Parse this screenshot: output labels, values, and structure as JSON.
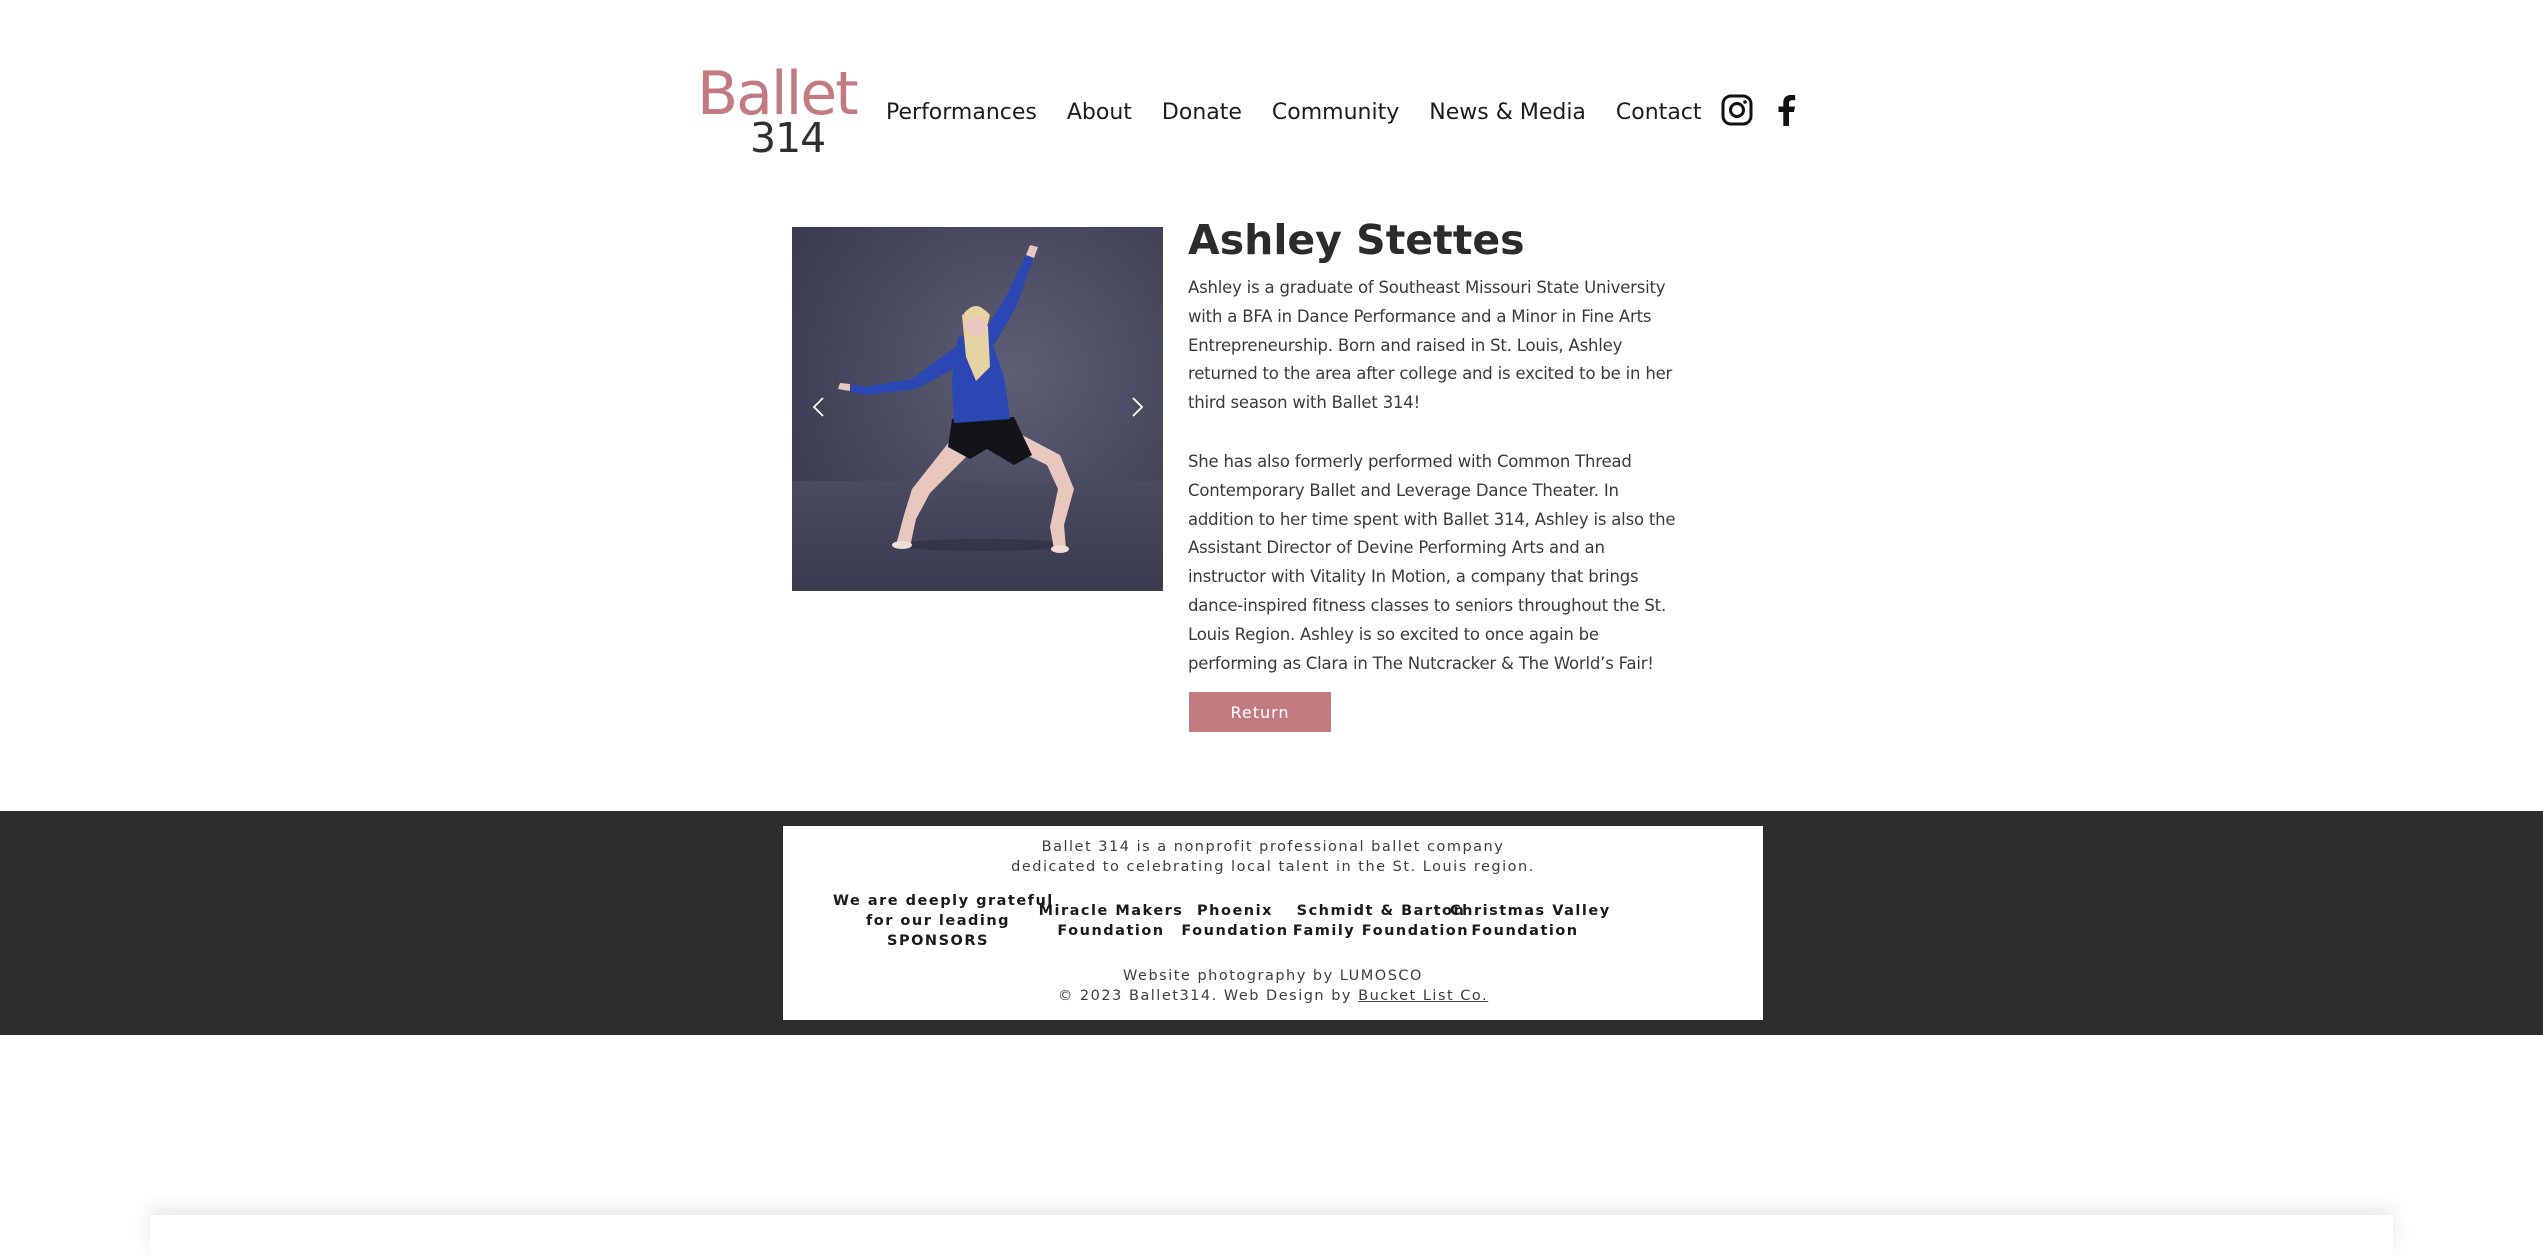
{
  "header": {
    "logo_word": "Ballet",
    "logo_number": "314",
    "nav": [
      "Performances",
      "About",
      "Donate",
      "Community",
      "News & Media",
      "Contact"
    ],
    "social_icons": [
      "instagram-icon",
      "facebook-icon"
    ]
  },
  "slideshow": {
    "prev_icon": "chevron-left-icon",
    "next_icon": "chevron-right-icon"
  },
  "profile": {
    "name": "Ashley Stettes",
    "bio_1": "Ashley is a graduate of Southeast Missouri State University with a BFA in Dance Performance and a Minor in Fine Arts Entrepreneurship. Born and raised in St. Louis, Ashley returned to the area after college and is excited to be in her third season with Ballet 314!",
    "bio_2": "She has also formerly performed with Common Thread Contemporary Ballet and Leverage Dance Theater. In addition to her time spent with Ballet 314, Ashley is also the Assistant Director of Devine Performing Arts and an instructor with Vitality In Motion, a company that brings dance-inspired fitness classes to seniors throughout the St. Louis Region. Ashley is so excited to once again be performing as Clara in The Nutcracker & The World’s Fair!",
    "return_label": "Return"
  },
  "footer": {
    "mission_line1": "Ballet 314 is a nonprofit professional ballet company",
    "mission_line2": "dedicated to celebrating local talent in the St. Louis region.",
    "sponsors_heading": [
      "We are deeply grateful",
      "for our leading",
      "SPONSORS"
    ],
    "sponsors": [
      [
        "Miracle Makers",
        "Foundation"
      ],
      [
        "Phoenix",
        "Foundation"
      ],
      [
        "Schmidt & Barton",
        "Family Foundation"
      ],
      [
        "Christmas Valley",
        "Foundation"
      ]
    ],
    "photo_credit": "Website photography by LUMOSCO",
    "copyright_prefix": "© 2023 Ballet314. Web Design by ",
    "design_link": "Bucket List Co."
  },
  "colors": {
    "brand": "#c27980",
    "footer_bg": "#2d2d2d",
    "text": "#2b2b2b"
  }
}
